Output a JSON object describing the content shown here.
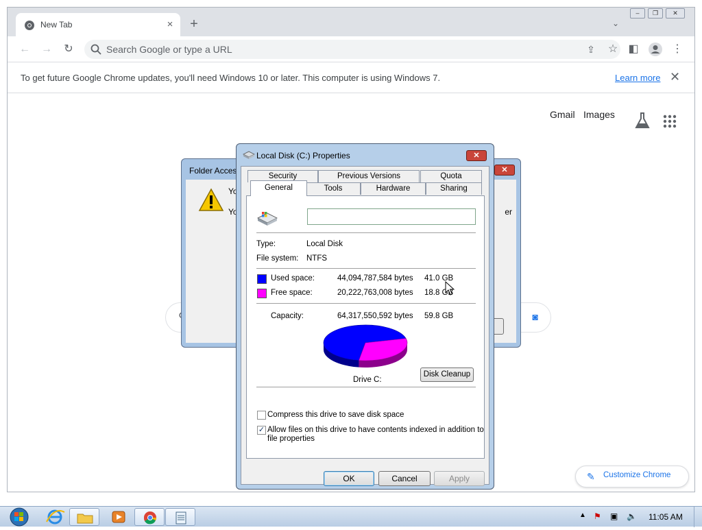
{
  "browser": {
    "tab_title": "New Tab",
    "tab_close": "×",
    "new_tab": "+",
    "omnibox_placeholder": "Search Google or type a URL",
    "info_message": "To get future Google Chrome updates, you'll need Windows 10 or later. This computer is using Windows 7.",
    "info_link": "Learn more",
    "info_close": "✕",
    "window_buttons": [
      "–",
      "❐",
      "✕"
    ]
  },
  "ntp": {
    "links": [
      "Gmail",
      "Images"
    ],
    "customize_label": "Customize Chrome"
  },
  "folder_dialog": {
    "title": "Folder Acces",
    "line1": "Yo",
    "line2": "Yo",
    "line2_tail": "er",
    "close": "✕"
  },
  "properties_dialog": {
    "title": "Local Disk (C:) Properties",
    "close": "✕",
    "tabs_top": [
      "Security",
      "Previous Versions",
      "Quota"
    ],
    "tabs_bottom": [
      "General",
      "Tools",
      "Hardware",
      "Sharing"
    ],
    "active_tab": "General",
    "drive_name_value": "",
    "type_label": "Type:",
    "type_value": "Local Disk",
    "fs_label": "File system:",
    "fs_value": "NTFS",
    "used_label": "Used space:",
    "used_bytes": "44,094,787,584 bytes",
    "used_gb": "41.0 GB",
    "free_label": "Free space:",
    "free_bytes": "20,222,763,008 bytes",
    "free_gb": "18.8 GB",
    "capacity_label": "Capacity:",
    "capacity_bytes": "64,317,550,592 bytes",
    "capacity_gb": "59.8 GB",
    "drive_label": "Drive C:",
    "cleanup_button": "Disk Cleanup",
    "compress_label": "Compress this drive to save disk space",
    "compress_checked": false,
    "index_label_1": "Allow files on this drive to have contents indexed in addition to",
    "index_label_2": "file properties",
    "index_checked": true,
    "ok": "OK",
    "cancel": "Cancel",
    "apply": "Apply",
    "used_color": "#0000ff",
    "free_color": "#ff00ff"
  },
  "chart_data": {
    "type": "pie",
    "categories": [
      "Used space",
      "Free space"
    ],
    "values": [
      44094787584,
      20222763008
    ],
    "colors": [
      "#0000ff",
      "#ff00ff"
    ],
    "title": "Drive C:"
  },
  "taskbar": {
    "items": [
      "start-orb",
      "internet-explorer-icon",
      "windows-explorer-icon",
      "media-player-icon",
      "chrome-icon",
      "notepad-icon"
    ],
    "clock": "11:05 AM"
  }
}
